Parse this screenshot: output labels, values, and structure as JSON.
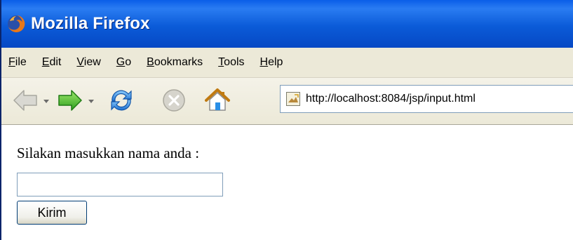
{
  "window": {
    "title": "Mozilla Firefox",
    "icon": "firefox-icon"
  },
  "menu": {
    "items": [
      {
        "label": "File",
        "accel": "F",
        "rest": "ile"
      },
      {
        "label": "Edit",
        "accel": "E",
        "rest": "dit"
      },
      {
        "label": "View",
        "accel": "V",
        "rest": "iew"
      },
      {
        "label": "Go",
        "accel": "G",
        "rest": "o"
      },
      {
        "label": "Bookmarks",
        "accel": "B",
        "rest": "ookmarks"
      },
      {
        "label": "Tools",
        "accel": "T",
        "rest": "ools"
      },
      {
        "label": "Help",
        "accel": "H",
        "rest": "elp"
      }
    ]
  },
  "toolbar": {
    "buttons": [
      "back-icon",
      "forward-icon",
      "reload-icon",
      "stop-icon",
      "home-icon"
    ],
    "url": "http://localhost:8084/jsp/input.html"
  },
  "page": {
    "prompt": "Silakan masukkan nama anda :",
    "input_value": "",
    "submit_label": "Kirim"
  }
}
